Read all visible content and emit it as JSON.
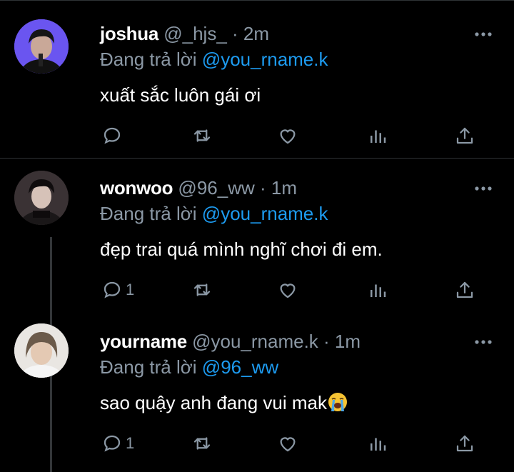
{
  "reply_prefix": "Đang trả lời",
  "tweets": [
    {
      "name": "joshua",
      "handle": "@_hjs_",
      "time": "· 2m",
      "reply_to": "@you_rname.k",
      "text": "xuất sắc luôn gái ơi",
      "reply_count": "",
      "icons": [
        "reply-icon",
        "retweet-icon",
        "like-icon",
        "views-icon",
        "share-icon",
        "more-icon"
      ]
    },
    {
      "name": "wonwoo",
      "handle": "@96_ww",
      "time": "· 1m",
      "reply_to": "@you_rname.k",
      "text": "đẹp trai quá mình nghĩ chơi đi em.",
      "reply_count": "1"
    },
    {
      "name": "yourname",
      "handle": "@you_rname.k",
      "time": "· 1m",
      "reply_to": "@96_ww",
      "text": "sao quậy anh đang vui mak",
      "reply_count": "1",
      "emoji": "loudly-crying-face-emoji"
    }
  ],
  "colors": {
    "background": "#000000",
    "text": "#e7e9ea",
    "muted": "#8b98a5",
    "link": "#1d9bf0",
    "divider": "#2f3336"
  }
}
